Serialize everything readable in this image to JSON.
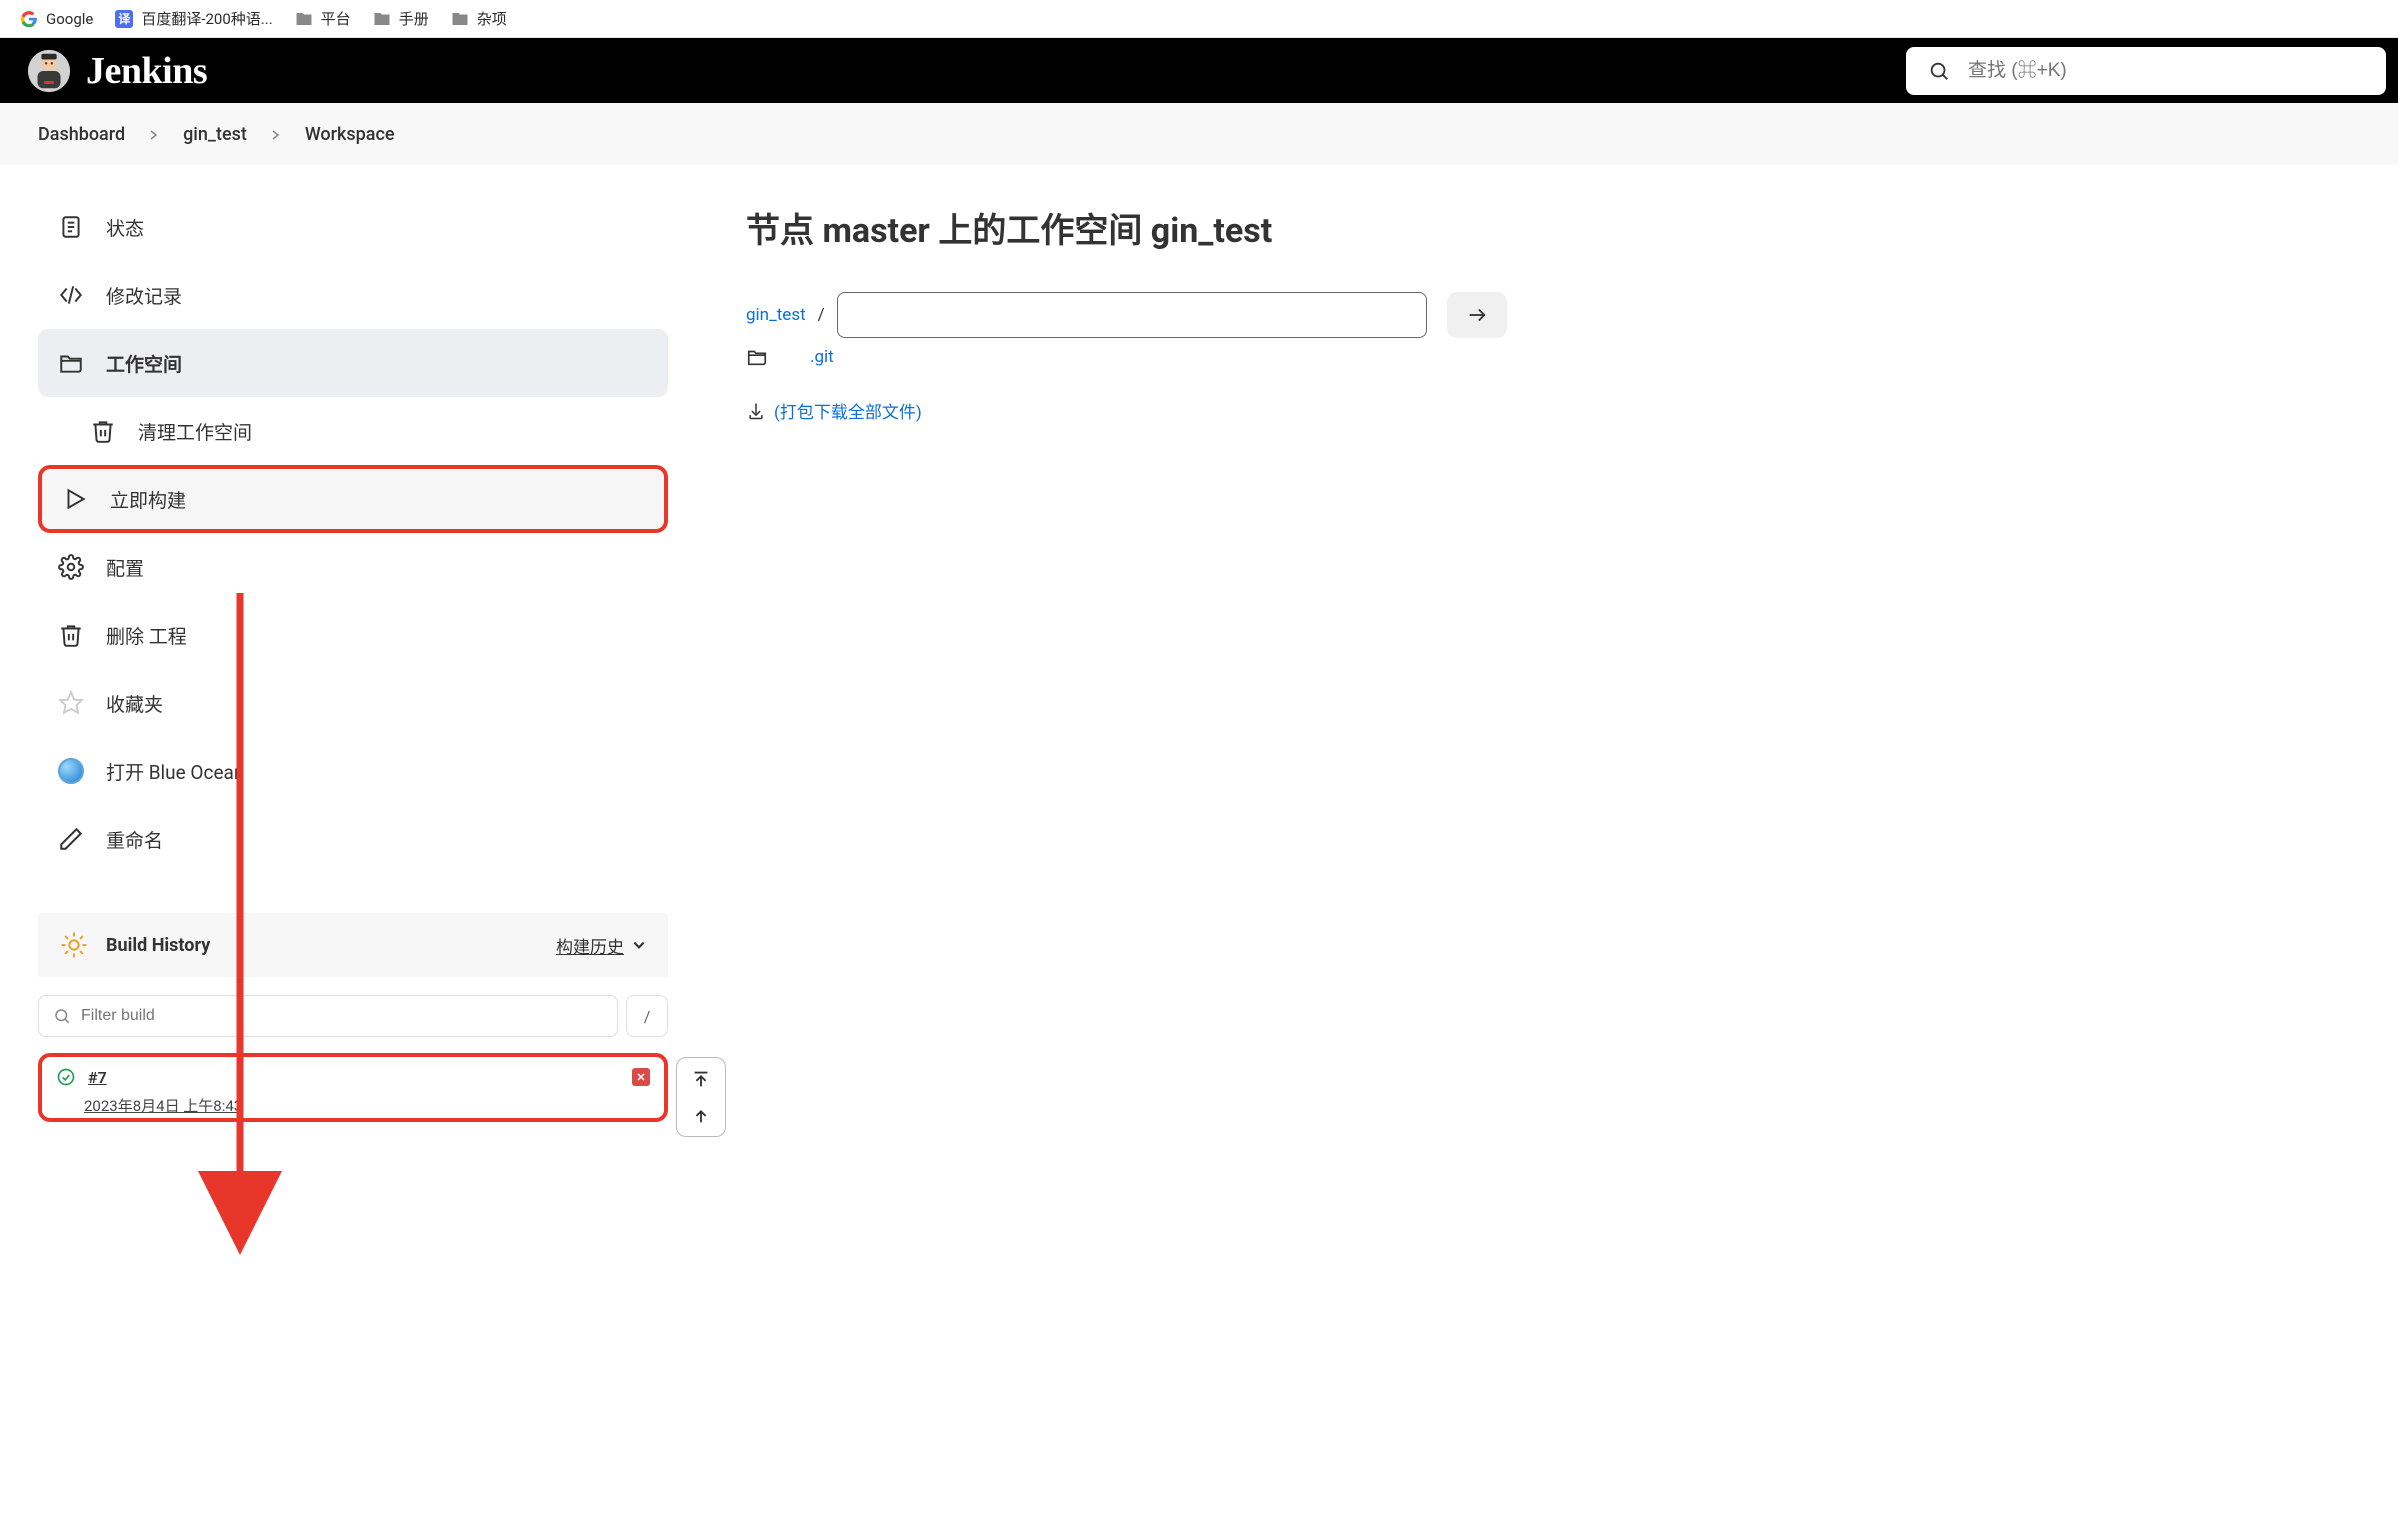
{
  "bookmarks": {
    "google": "Google",
    "baidu": "百度翻译-200种语...",
    "folders": [
      "平台",
      "手册",
      "杂项"
    ]
  },
  "header": {
    "brand": "Jenkins",
    "search_placeholder": "查找 (⌘+K)"
  },
  "breadcrumb": {
    "items": [
      "Dashboard",
      "gin_test",
      "Workspace"
    ]
  },
  "sidebar": {
    "status": "状态",
    "changes": "修改记录",
    "workspace": "工作空间",
    "clean_ws": "清理工作空间",
    "build_now": "立即构建",
    "configure": "配置",
    "delete_project": "删除 工程",
    "favorites": "收藏夹",
    "blue_ocean": "打开 Blue Ocean",
    "rename": "重命名"
  },
  "build_history": {
    "title": "Build History",
    "link": "构建历史",
    "filter_placeholder": "Filter build",
    "shortcut": "/",
    "latest": {
      "num": "#7",
      "date": "2023年8月4日 上午8:43"
    }
  },
  "main": {
    "title": "节点 master 上的工作空间 gin_test",
    "project_link": "gin_test",
    "path_sep": "/",
    "git_folder": ".git",
    "download_all": "(打包下载全部文件)"
  }
}
